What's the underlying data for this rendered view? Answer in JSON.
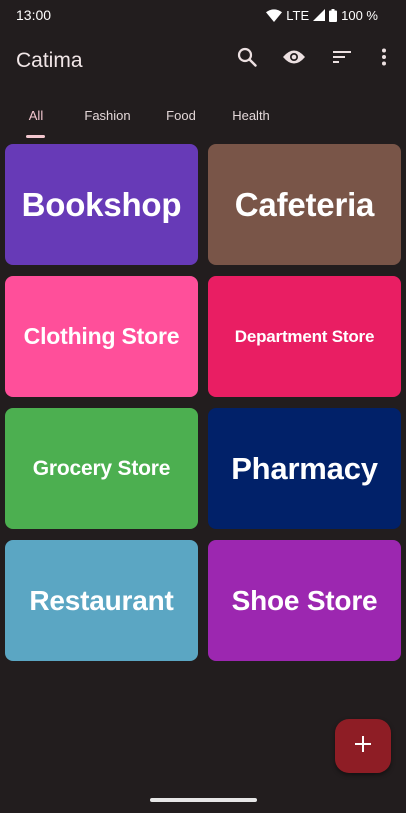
{
  "status_bar": {
    "time": "13:00",
    "network": "LTE",
    "battery": "100 %"
  },
  "app_bar": {
    "title": "Catima",
    "actions": [
      "search-icon",
      "eye-icon",
      "sort-icon",
      "more-vert-icon"
    ]
  },
  "tabs": [
    {
      "label": "All",
      "active": true
    },
    {
      "label": "Fashion",
      "active": false
    },
    {
      "label": "Food",
      "active": false
    },
    {
      "label": "Health",
      "active": false
    }
  ],
  "cards": [
    {
      "label": "Bookshop",
      "color": "#673ab7"
    },
    {
      "label": "Cafeteria",
      "color": "#795548"
    },
    {
      "label": "Clothing Store",
      "color": "#ff4f9a"
    },
    {
      "label": "Department Store",
      "color": "#e91e63"
    },
    {
      "label": "Grocery Store",
      "color": "#4caf50"
    },
    {
      "label": "Pharmacy",
      "color": "#012169"
    },
    {
      "label": "Restaurant",
      "color": "#5ba6c3"
    },
    {
      "label": "Shoe Store",
      "color": "#9c27b0"
    }
  ],
  "fab": {
    "icon": "plus-icon",
    "color": "#8e1d25"
  },
  "colors": {
    "background": "#221d1e",
    "tab_active": "#f3c7cf"
  }
}
